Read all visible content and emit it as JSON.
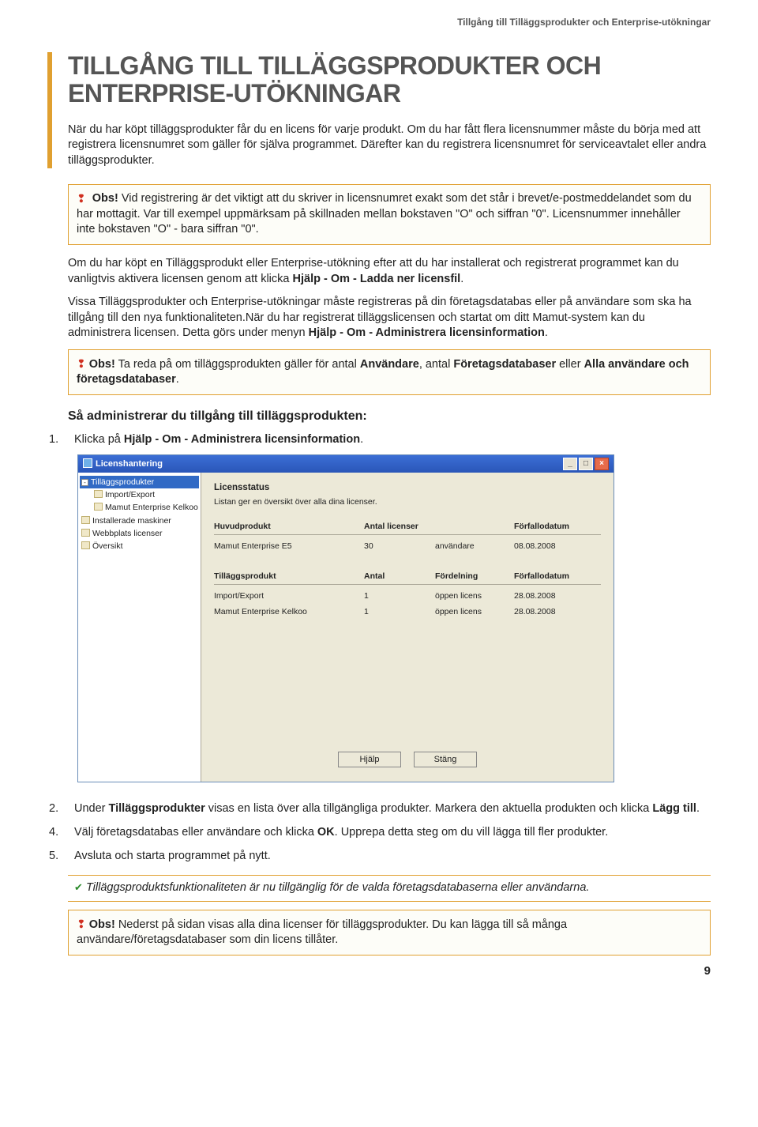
{
  "headerTag": "Tillgång till Tilläggsprodukter och Enterprise-utökningar",
  "title": "TILLGÅNG TILL TILLÄGGSPRODUKTER OCH ENTERPRISE-UTÖKNINGAR",
  "intro1": "När du har köpt tilläggsprodukter får du en licens för varje produkt. Om du har fått flera licensnummer måste du börja med att registrera licensnumret som gäller för själva programmet. Därefter kan du registrera licensnumret för serviceavtalet eller andra tilläggsprodukter.",
  "obs1_b": "Obs!",
  "obs1_text": " Vid registrering är det viktigt att du skriver in licensnumret exakt som det står i brevet/e-postmeddelandet som du har mottagit. Var till exempel uppmärksam på skillnaden mellan bokstaven \"O\" och siffran \"0\". Licensnummer innehåller inte bokstaven \"O\" - bara siffran \"0\".",
  "p2a": "Om du  har köpt en Tilläggsprodukt eller Enterprise-utökning efter att du har installerat och registrerat programmet kan du vanligtvis aktivera licensen genom att klicka ",
  "p2b": "Hjälp - Om - Ladda ner licensfil",
  "p2c": ".",
  "p3a": "Vissa Tilläggsprodukter och Enterprise-utökningar måste registreras på din företagsdatabas eller på användare som ska ha tillgång till den nya funktionaliteten.När du har registrerat tilläggslicensen och startat om ditt Mamut-system kan du administrera licensen. Detta görs under menyn ",
  "p3b": "Hjälp - Om - Administrera licensinformation",
  "p3c": ".",
  "obs2_b": "Obs!",
  "obs2_a": " Ta reda på om tilläggsprodukten gäller för antal ",
  "obs2_u1": "Användare",
  "obs2_m1": ", antal ",
  "obs2_u2": "Företagsdatabaser",
  "obs2_m2": " eller ",
  "obs2_u3": "Alla användare och företagsdatabaser",
  "obs2_end": ".",
  "subhead": "Så administrerar du tillgång till tilläggsprodukten:",
  "step1_n": "1.",
  "step1_a": "Klicka på ",
  "step1_b": "Hjälp - Om - Administrera licensinformation",
  "step1_c": ".",
  "step2_n": "2.",
  "step2_a": "Under ",
  "step2_b": "Tilläggsprodukter",
  "step2_c": " visas en lista över alla tillgängliga produkter. Markera den aktuella produkten och klicka ",
  "step2_d": "Lägg till",
  "step2_e": ".",
  "step4_n": "4.",
  "step4_a": "Välj företagsdatabas eller användare och klicka ",
  "step4_b": "OK",
  "step4_c": ". Upprepa detta steg om du vill lägga till fler produkter.",
  "step5_n": "5.",
  "step5_t": "Avsluta och starta programmet på nytt.",
  "success": "Tilläggsproduktsfunktionaliteten är nu tillgänglig för de valda företagsdatabaserna eller användarna.",
  "obs3_b": "Obs!",
  "obs3_t": " Nederst på sidan visas alla dina licenser för tilläggsprodukter. Du kan lägga till så många användare/företagsdatabaser som din licens tillåter.",
  "pageNum": "9",
  "win": {
    "title": "Licenshantering",
    "tree": {
      "root": "Tilläggsprodukter",
      "items": [
        "Import/Export",
        "Mamut Enterprise Kelkoo"
      ],
      "n2": "Installerade maskiner",
      "n3": "Webbplats licenser",
      "n4": "Översikt"
    },
    "content": {
      "heading": "Licensstatus",
      "desc": "Listan ger en översikt över alla dina licenser.",
      "t1h": {
        "c1": "Huvudprodukt",
        "c2": "Antal licenser",
        "c4": "Förfallodatum"
      },
      "t1r": {
        "c1": "Mamut Enterprise E5",
        "c2": "30",
        "c3": "användare",
        "c4": "08.08.2008"
      },
      "t2h": {
        "c1": "Tilläggsprodukt",
        "c2": "Antal",
        "c3": "Fördelning",
        "c4": "Förfallodatum"
      },
      "t2r1": {
        "c1": "Import/Export",
        "c2": "1",
        "c3": "öppen licens",
        "c4": "28.08.2008"
      },
      "t2r2": {
        "c1": "Mamut Enterprise Kelkoo",
        "c2": "1",
        "c3": "öppen licens",
        "c4": "28.08.2008"
      },
      "btnHelp": "Hjälp",
      "btnClose": "Stäng"
    }
  }
}
